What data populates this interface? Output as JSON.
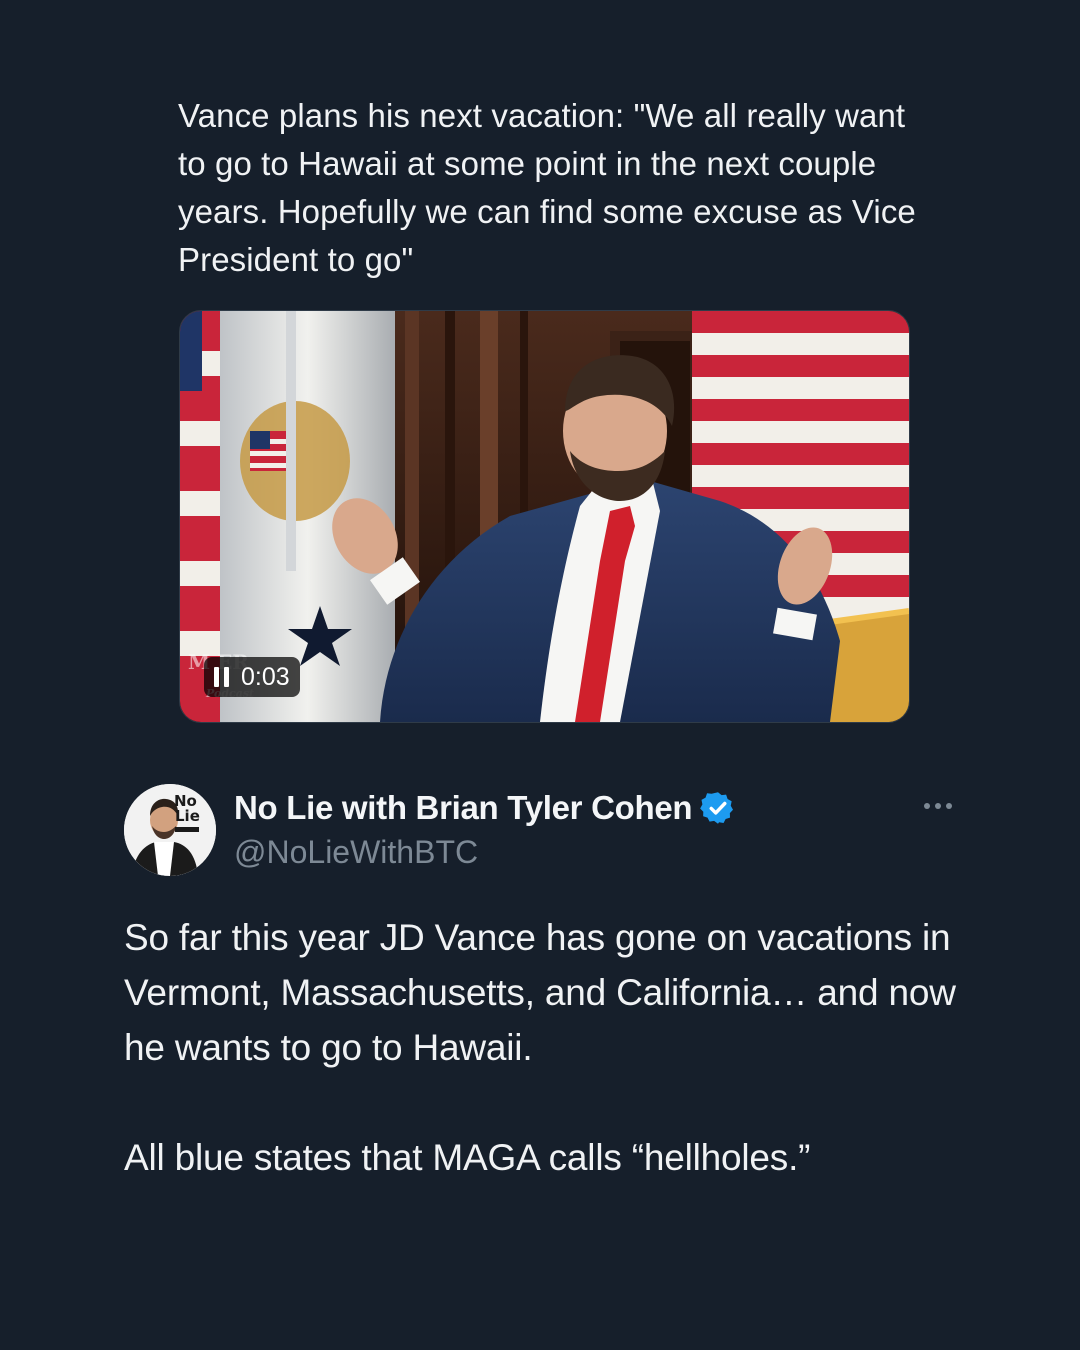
{
  "quoted_post": {
    "text": "Vance plans his next vacation: \"We all really want to go to Hawaii at some point in the next couple years. Hopefully we can find some excuse as Vice President to go\"",
    "video": {
      "elapsed_time": "0:03",
      "playback_state": "playing",
      "control_icon": "pause-icon"
    }
  },
  "post": {
    "author": {
      "display_name": "No Lie with Brian Tyler Cohen",
      "handle": "@NoLieWithBTC",
      "verified": true,
      "avatar_logo_text": "No Lie"
    },
    "more_icon": "more-horizontal-icon",
    "body_paragraphs": [
      "So far this year JD Vance has gone on vacations in Vermont, Massachusetts, and California… and now he wants to go to Hawaii.",
      "All blue states that MAGA calls “hellholes.”"
    ]
  },
  "colors": {
    "background": "#161f2b",
    "text_primary": "#f0f2f4",
    "text_secondary": "#7d8995",
    "verified_badge": "#1d9bf0"
  }
}
